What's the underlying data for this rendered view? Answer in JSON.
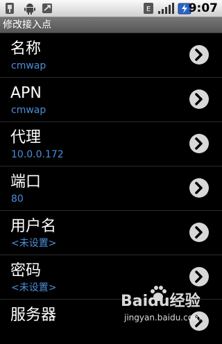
{
  "status_bar": {
    "icons": [
      "usb-debug-icon",
      "android-icon",
      "missed-call-icon",
      "network-type-icon",
      "signal-icon",
      "battery-charging-icon"
    ],
    "time": "9:07"
  },
  "title_bar": {
    "title": "修改接入点"
  },
  "settings": [
    {
      "label": "名称",
      "value": "cmwap"
    },
    {
      "label": "APN",
      "value": "cmwap"
    },
    {
      "label": "代理",
      "value": "10.0.0.172"
    },
    {
      "label": "端口",
      "value": "80"
    },
    {
      "label": "用户名",
      "value": "<未设置>"
    },
    {
      "label": "密码",
      "value": "<未设置>"
    },
    {
      "label": "服务器",
      "value": ""
    }
  ],
  "watermark": {
    "brand": "Baidu经验",
    "url": "jingyan.baidu.com"
  },
  "colors": {
    "value_blue": "#4a8fd9",
    "background": "#000000"
  }
}
